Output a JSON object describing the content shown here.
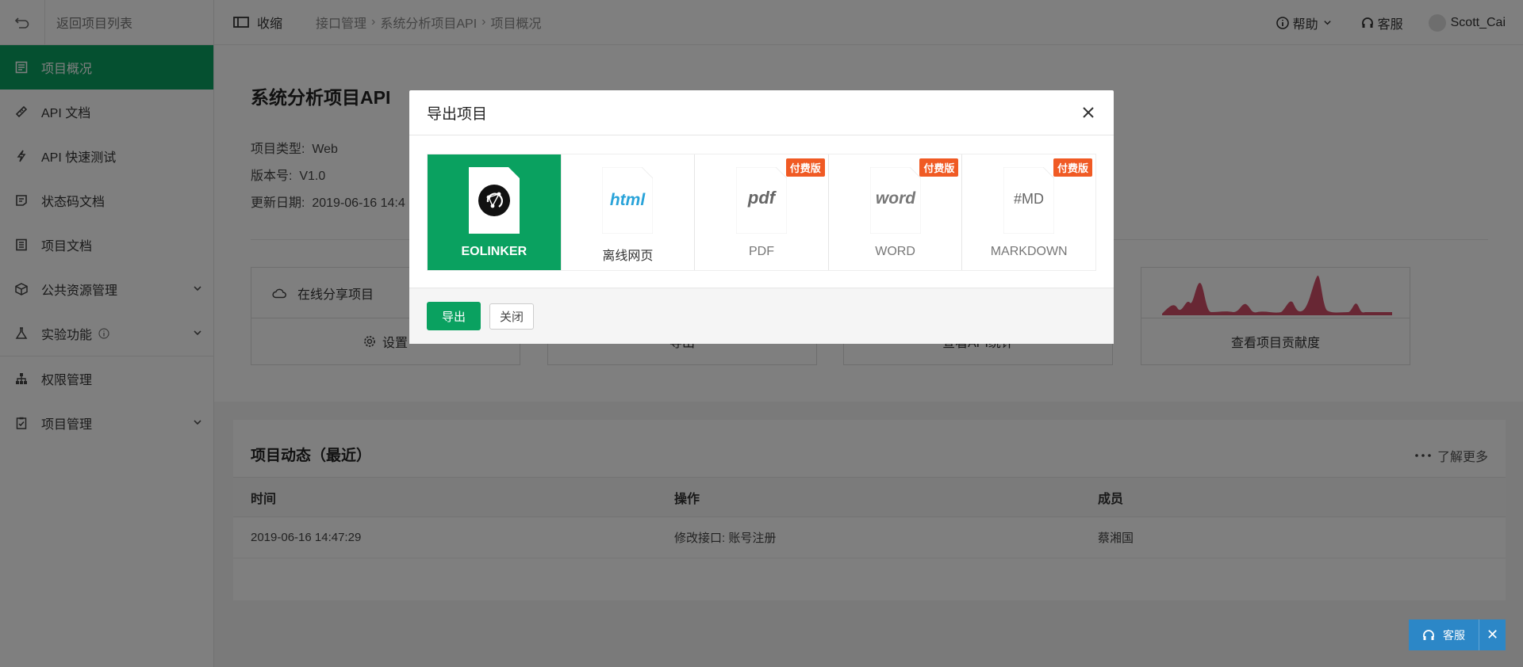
{
  "sidebar": {
    "back_label": "返回项目列表",
    "items": [
      {
        "label": "项目概况",
        "active": true
      },
      {
        "label": "API 文档"
      },
      {
        "label": "API 快速测试"
      },
      {
        "label": "状态码文档"
      },
      {
        "label": "项目文档"
      },
      {
        "label": "公共资源管理",
        "expandable": true
      },
      {
        "label": "实验功能",
        "expandable": true
      },
      {
        "label": "权限管理"
      },
      {
        "label": "项目管理",
        "expandable": true
      }
    ]
  },
  "topbar": {
    "collapse_label": "收缩",
    "breadcrumb": [
      "接口管理",
      "系统分析项目API",
      "项目概况"
    ],
    "help_label": "帮助",
    "service_label": "客服",
    "user_name": "Scott_Cai"
  },
  "project": {
    "title": "系统分析项目API",
    "type_label": "项目类型:",
    "type_value": "Web",
    "version_label": "版本号:",
    "version_value": "V1.0",
    "updated_label": "更新日期:",
    "updated_value": "2019-06-16 14:4"
  },
  "tiles": {
    "share_label": "在线分享项目",
    "settings_label": "设置",
    "export_label": "导出",
    "stats_label": "查看API统计",
    "contrib_label": "查看项目贡献度"
  },
  "dynamics": {
    "title": "项目动态（最近）",
    "more_label": "了解更多",
    "columns": [
      "时间",
      "操作",
      "成员"
    ],
    "rows": [
      {
        "time": "2019-06-16 14:47:29",
        "action": "修改接口: 账号注册",
        "member": "蔡湘国"
      }
    ]
  },
  "modal": {
    "title": "导出项目",
    "options": [
      {
        "label": "EOLINKER",
        "icon": "eolinker-icon",
        "selected": true,
        "paid": false
      },
      {
        "label": "离线网页",
        "icon_text": "html",
        "paid": false
      },
      {
        "label": "PDF",
        "icon_text": "pdf",
        "paid": true
      },
      {
        "label": "WORD",
        "icon_text": "word",
        "paid": true
      },
      {
        "label": "MARKDOWN",
        "icon_text": "#MD",
        "paid": true
      }
    ],
    "paid_badge": "付费版",
    "export_button": "导出",
    "close_button": "关闭"
  },
  "float_service": {
    "label": "客服"
  },
  "colors": {
    "accent": "#0aa160",
    "badge": "#f05a24",
    "float_blue": "#2c87c7",
    "spark": "#c8304e"
  }
}
